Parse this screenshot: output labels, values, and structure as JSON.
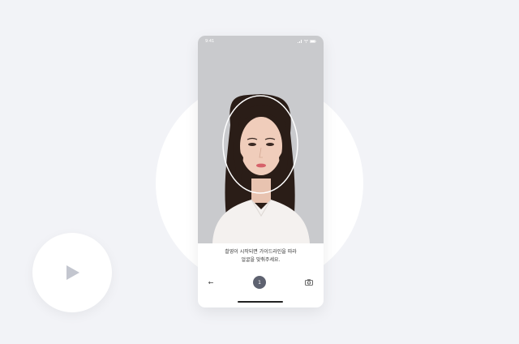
{
  "status_bar": {
    "time": "9:41",
    "icons": [
      "signal-icon",
      "wifi-icon",
      "battery-icon"
    ]
  },
  "camera": {
    "guide": "face-guide-outline",
    "subject": "portrait-photo"
  },
  "instructions": {
    "line1": "촬영이 시작되면 가이드라인을 따라",
    "line2": "얼굴을 맞춰주세요."
  },
  "controls": {
    "back_icon": "←",
    "shutter_label": "1",
    "switch_icon": "camera-switch-icon"
  },
  "video": {
    "play_icon": "play-icon"
  },
  "colors": {
    "background": "#f2f3f7",
    "shutter": "#5e6270",
    "play": "#c3c6cf"
  }
}
